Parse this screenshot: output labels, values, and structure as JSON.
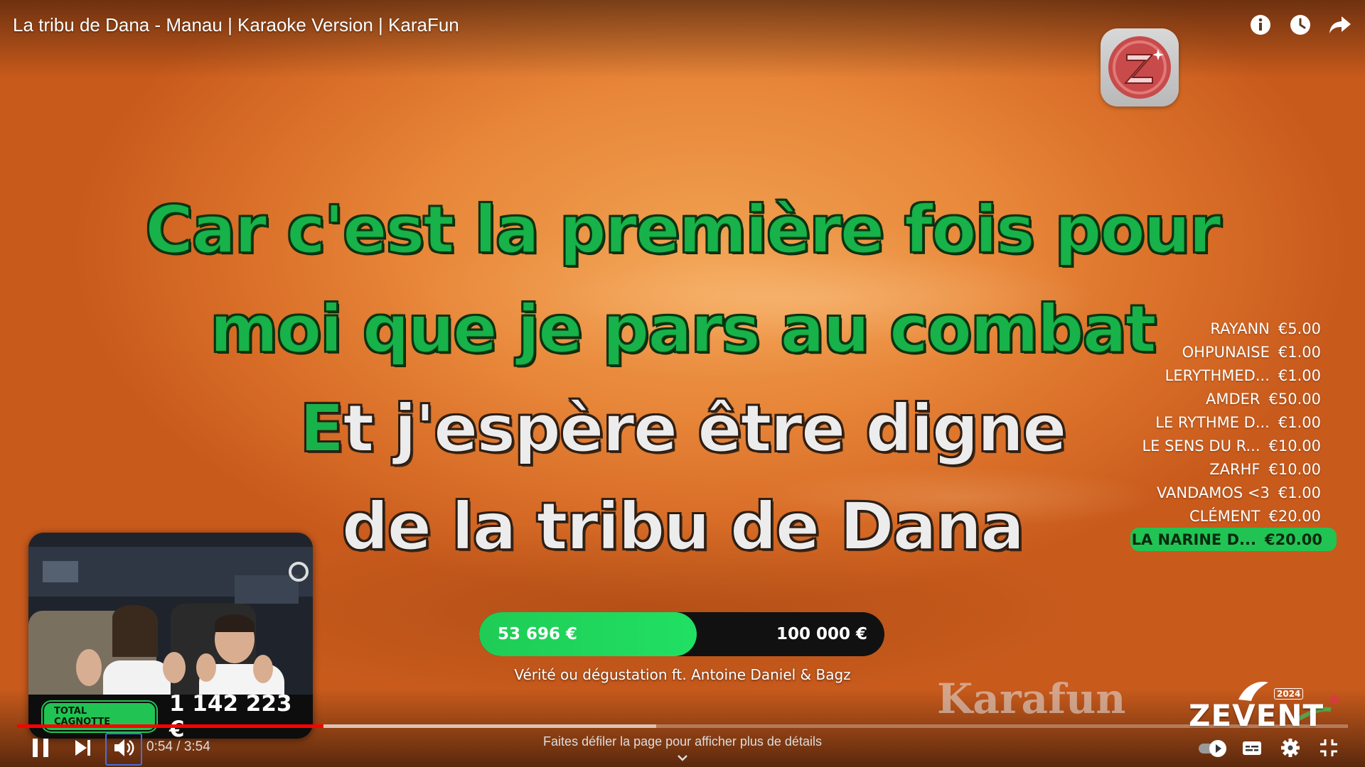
{
  "player": {
    "title": "La tribu de Dana - Manau | Karaoke Version | KaraFun",
    "current_time": "0:54",
    "duration": "3:54",
    "time_separator": " / ",
    "scroll_hint": "Faites défiler la page pour afficher plus de détails",
    "played_fraction": 0.23,
    "buffered_fraction": 0.48,
    "accent_color": "#ff0000"
  },
  "lyrics": {
    "line1": "Car c'est la première fois pour",
    "line2": "moi que je pars au combat",
    "line3_first": "E",
    "line3_rest": "t j'espère être digne",
    "line4": "de la tribu de Dana",
    "sung_color": "#17b24a",
    "unsung_color": "#ececec"
  },
  "donations": [
    {
      "name": "RAYANN",
      "amount": "€5.00"
    },
    {
      "name": "OHPUNAISE",
      "amount": "€1.00"
    },
    {
      "name": "LERYTHMED...",
      "amount": "€1.00"
    },
    {
      "name": "AMDER",
      "amount": "€50.00"
    },
    {
      "name": "LE RYTHME D...",
      "amount": "€1.00"
    },
    {
      "name": "LE SENS DU R...",
      "amount": "€10.00"
    },
    {
      "name": "ZARHF",
      "amount": "€10.00"
    },
    {
      "name": "VANDAMOS <3",
      "amount": "€1.00"
    },
    {
      "name": "CLÉMENT",
      "amount": "€20.00"
    },
    {
      "name": "LA NARINE D...",
      "amount": "€20.00",
      "highlighted": true
    }
  ],
  "goal": {
    "current": "53 696 €",
    "target": "100 000 €",
    "fraction": 0.537,
    "subtitle": "Vérité ou dégustation ft. Antoine Daniel & Bagz"
  },
  "stream": {
    "cagnotte_label": "TOTAL CAGNOTTE",
    "cagnotte_amount": "1 142 223 €",
    "watermark": "Karafun",
    "event_logo": "ZEVENT",
    "event_year": "2024"
  },
  "icons": {
    "info": "info-icon",
    "watch_later": "clock-icon",
    "share": "share-icon",
    "pause": "pause-icon",
    "next": "next-icon",
    "volume": "volume-icon",
    "autoplay": "autoplay-toggle-icon",
    "subtitles": "subtitles-icon",
    "settings": "gear-icon",
    "exit_fullscreen": "exit-fullscreen-icon",
    "chevron": "chevron-down-icon"
  },
  "colors": {
    "highlight_green": "#21c453",
    "progress_green": "#20e063"
  }
}
